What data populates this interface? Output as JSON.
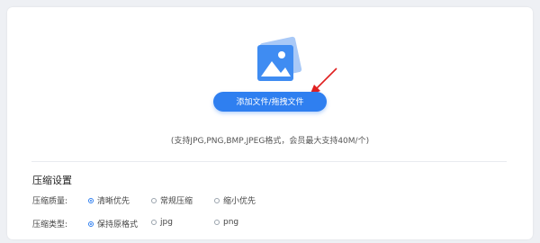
{
  "upload": {
    "button_label": "添加文件/拖拽文件",
    "support_text": "(支持JPG,PNG,BMP,JPEG格式，会员最大支持40M/个)"
  },
  "settings": {
    "title": "压缩设置",
    "quality": {
      "label": "压缩质量:",
      "options": [
        {
          "label": "清晰优先",
          "checked": true
        },
        {
          "label": "常规压缩",
          "checked": false
        },
        {
          "label": "缩小优先",
          "checked": false
        }
      ]
    },
    "type": {
      "label": "压缩类型:",
      "options": [
        {
          "label": "保持原格式",
          "checked": true
        },
        {
          "label": "jpg",
          "checked": false
        },
        {
          "label": "png",
          "checked": false
        }
      ]
    }
  },
  "colors": {
    "accent": "#2f7ff0",
    "arrow": "#e02020",
    "background": "#eef0f4"
  }
}
